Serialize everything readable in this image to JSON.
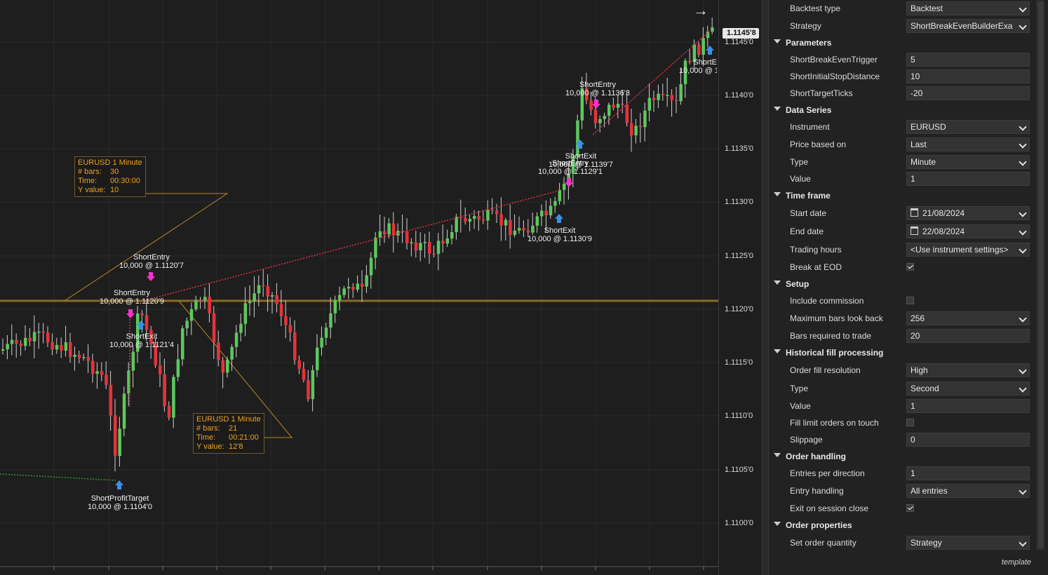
{
  "chart": {
    "price_labels": [
      "1.1145'0",
      "1.1140'0",
      "1.1135'0",
      "1.1130'0",
      "1.1125'0",
      "1.1120'0",
      "1.1115'0",
      "1.1110'0",
      "1.1105'0",
      "1.1100'0"
    ],
    "last_price": "1.1145'8",
    "markers": [
      {
        "title": "ShortEntry",
        "detail": "10,000 @ 1.1120'7"
      },
      {
        "title": "ShortEntry",
        "detail": "10,000 @ 1.1120'9"
      },
      {
        "title": "ShortExit",
        "detail": "10,000 @ 1.1121'4"
      },
      {
        "title": "ShortProfitTarget",
        "detail": "10,000 @ 1.1104'0"
      },
      {
        "title": "ShortEntry",
        "detail": "10,000 @ 1.1136'3"
      },
      {
        "title": "ShortExit",
        "detail": "10,000 @ 1.1139'7"
      },
      {
        "title": "ShortEntry",
        "detail": "10,000 @ 1.1129'1"
      },
      {
        "title": "ShortExit",
        "detail": "10,000 @ 1.1130'9"
      },
      {
        "title": "ShortE",
        "detail": "10,000 @ 1"
      }
    ],
    "info_boxes": [
      {
        "title": "EURUSD 1 Minute",
        "bars_label": "# bars:",
        "bars": "30",
        "time_label": "Time:",
        "time": "00:30:00",
        "y_label": "Y value:",
        "y": "10"
      },
      {
        "title": "EURUSD 1 Minute",
        "bars_label": "# bars:",
        "bars": "21",
        "time_label": "Time:",
        "time": "00:21:00",
        "y_label": "Y value:",
        "y": "12'8"
      }
    ],
    "colors": {
      "up": "#5cc85c",
      "down": "#e8323c",
      "wick": "#d0d0d0",
      "entry_arrow": "#ff30d0",
      "exit_arrow": "#3a8fe8",
      "trade_line": "#e0304a",
      "horizontal_line": "#8a6a2a"
    }
  },
  "panel": {
    "rows": [
      {
        "type": "field",
        "label": "Backtest type",
        "value": "Backtest",
        "dropdown": true
      },
      {
        "type": "field",
        "label": "Strategy",
        "value": "ShortBreakEvenBuilderExa",
        "dropdown": true
      },
      {
        "type": "section",
        "label": "Parameters"
      },
      {
        "type": "field",
        "label": "ShortBreakEvenTrigger",
        "value": "5"
      },
      {
        "type": "field",
        "label": "ShortInitialStopDistance",
        "value": "10"
      },
      {
        "type": "field",
        "label": "ShortTargetTicks",
        "value": "-20"
      },
      {
        "type": "section",
        "label": "Data Series"
      },
      {
        "type": "field",
        "label": "Instrument",
        "value": "EURUSD",
        "dropdown": true
      },
      {
        "type": "field",
        "label": "Price based on",
        "value": "Last",
        "dropdown": true
      },
      {
        "type": "field",
        "label": "Type",
        "value": "Minute",
        "dropdown": true
      },
      {
        "type": "field",
        "label": "Value",
        "value": "1"
      },
      {
        "type": "section",
        "label": "Time frame"
      },
      {
        "type": "field",
        "label": "Start date",
        "value": "21/08/2024",
        "dropdown": true,
        "calendar": true
      },
      {
        "type": "field",
        "label": "End date",
        "value": "22/08/2024",
        "dropdown": true,
        "calendar": true
      },
      {
        "type": "field",
        "label": "Trading hours",
        "value": "<Use instrument settings>",
        "dropdown": true
      },
      {
        "type": "check",
        "label": "Break at EOD",
        "checked": true
      },
      {
        "type": "section",
        "label": "Setup"
      },
      {
        "type": "check",
        "label": "Include commission",
        "checked": false
      },
      {
        "type": "field",
        "label": "Maximum bars look back",
        "value": "256",
        "dropdown": true
      },
      {
        "type": "field",
        "label": "Bars required to trade",
        "value": "20"
      },
      {
        "type": "section",
        "label": "Historical fill processing"
      },
      {
        "type": "field",
        "label": "Order fill resolution",
        "value": "High",
        "dropdown": true
      },
      {
        "type": "field",
        "label": "Type",
        "value": "Second",
        "dropdown": true
      },
      {
        "type": "field",
        "label": "Value",
        "value": "1"
      },
      {
        "type": "check",
        "label": "Fill limit orders on touch",
        "checked": false
      },
      {
        "type": "field",
        "label": "Slippage",
        "value": "0"
      },
      {
        "type": "section",
        "label": "Order handling"
      },
      {
        "type": "field",
        "label": "Entries per direction",
        "value": "1"
      },
      {
        "type": "field",
        "label": "Entry handling",
        "value": "All entries",
        "dropdown": true
      },
      {
        "type": "check",
        "label": "Exit on session close",
        "checked": true
      },
      {
        "type": "section",
        "label": "Order properties"
      },
      {
        "type": "field",
        "label": "Set order quantity",
        "value": "Strategy",
        "dropdown": true
      }
    ],
    "template_link": "template"
  }
}
